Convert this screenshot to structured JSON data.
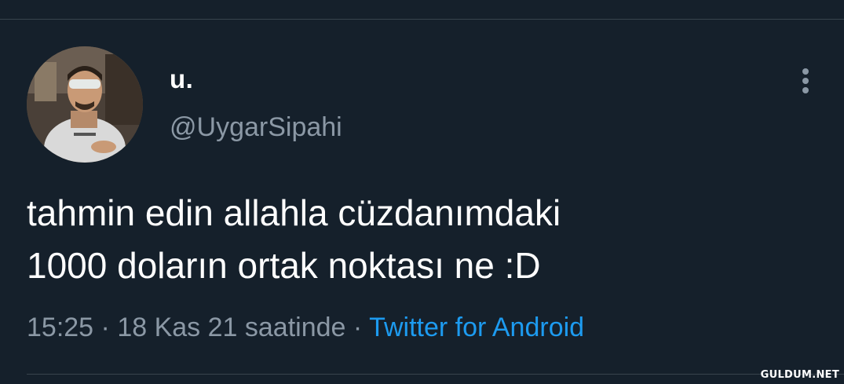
{
  "tweet": {
    "display_name": "u.",
    "handle": "@UygarSipahi",
    "text_lines": [
      "tahmin edin allahla cüzdanımdaki",
      "1000 doların ortak noktası ne :D"
    ],
    "time": "15:25",
    "separator": "·",
    "date": "18 Kas 21 saatinde",
    "source": "Twitter for Android"
  },
  "icons": {
    "more": "more-vertical-icon"
  },
  "watermark": "GULDUM.NET",
  "colors": {
    "background": "#15202b",
    "text_primary": "#ffffff",
    "text_secondary": "#8b98a5",
    "link": "#1d9bf0",
    "divider": "#38444d"
  }
}
